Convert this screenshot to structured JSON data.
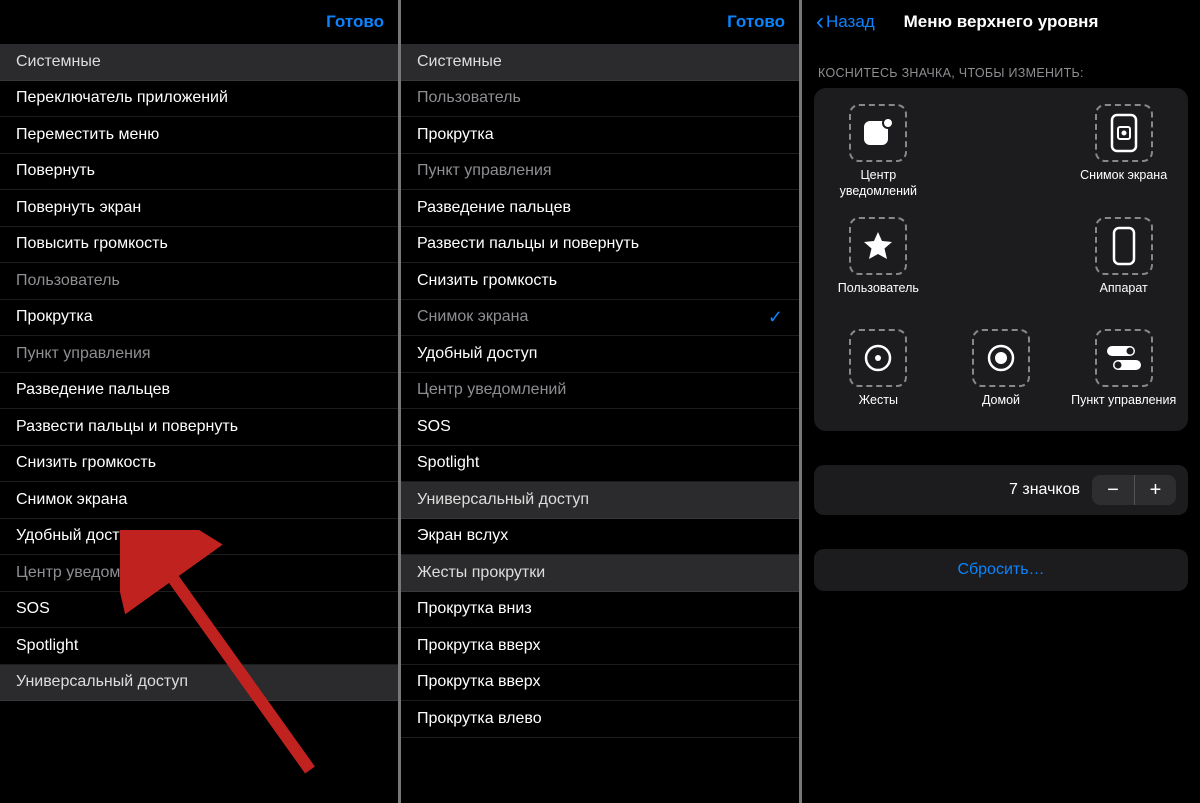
{
  "nav": {
    "done": "Готово",
    "back": "Назад",
    "title3": "Меню верхнего уровня"
  },
  "panel1": {
    "rows": [
      {
        "t": "Системные",
        "kind": "header"
      },
      {
        "t": "Переключатель приложений"
      },
      {
        "t": "Переместить меню"
      },
      {
        "t": "Повернуть"
      },
      {
        "t": "Повернуть экран"
      },
      {
        "t": "Повысить громкость"
      },
      {
        "t": "Пользователь",
        "kind": "dim"
      },
      {
        "t": "Прокрутка"
      },
      {
        "t": "Пункт управления",
        "kind": "dim"
      },
      {
        "t": "Разведение пальцев"
      },
      {
        "t": "Развести пальцы и повернуть"
      },
      {
        "t": "Снизить громкость"
      },
      {
        "t": "Снимок экрана"
      },
      {
        "t": "Удобный доступ"
      },
      {
        "t": "Центр уведомлений",
        "kind": "dim"
      },
      {
        "t": "SOS"
      },
      {
        "t": "Spotlight"
      },
      {
        "t": "Универсальный доступ",
        "kind": "header"
      }
    ]
  },
  "panel2": {
    "rows": [
      {
        "t": "Системные",
        "kind": "header"
      },
      {
        "t": "Пользователь",
        "kind": "dim"
      },
      {
        "t": "Прокрутка"
      },
      {
        "t": "Пункт управления",
        "kind": "dim"
      },
      {
        "t": "Разведение пальцев"
      },
      {
        "t": "Развести пальцы и повернуть"
      },
      {
        "t": "Снизить громкость"
      },
      {
        "t": "Снимок экрана",
        "kind": "dim",
        "checked": true
      },
      {
        "t": "Удобный доступ"
      },
      {
        "t": "Центр уведомлений",
        "kind": "dim"
      },
      {
        "t": "SOS"
      },
      {
        "t": "Spotlight"
      },
      {
        "t": "Универсальный доступ",
        "kind": "header"
      },
      {
        "t": "Экран вслух"
      },
      {
        "t": "Жесты прокрутки",
        "kind": "header"
      },
      {
        "t": "Прокрутка вниз"
      },
      {
        "t": "Прокрутка вверх"
      },
      {
        "t": "Прокрутка вверх"
      },
      {
        "t": "Прокрутка влево"
      }
    ]
  },
  "panel3": {
    "hint": "КОСНИТЕСЬ ЗНАЧКА, ЧТОБЫ ИЗМЕНИТЬ:",
    "icons": [
      {
        "label": "Центр уведомлений",
        "icon": "notif"
      },
      {
        "label": "Снимок экрана",
        "icon": "screenshot"
      },
      {
        "label": "Пользователь",
        "icon": "star"
      },
      {
        "label": "Аппарат",
        "icon": "device"
      },
      {
        "label": "Жесты",
        "icon": "gesture"
      },
      {
        "label": "Домой",
        "icon": "home"
      },
      {
        "label": "Пункт управления",
        "icon": "toggles"
      }
    ],
    "count_label": "7 значков",
    "reset": "Сбросить…"
  }
}
